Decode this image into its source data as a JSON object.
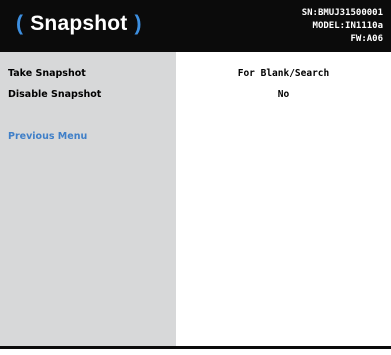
{
  "header": {
    "title_open": "(",
    "title": "Snapshot",
    "title_close": ")",
    "serial": "SN:BMUJ31500001",
    "model": "MODEL:IN1110a",
    "firmware": "FW:A06"
  },
  "menu": {
    "items": [
      {
        "label": "Take Snapshot",
        "value": "For Blank/Search"
      },
      {
        "label": "Disable Snapshot",
        "value": "No"
      }
    ],
    "previous_menu": "Previous Menu"
  },
  "colors": {
    "header_bg": "#0b0b0b",
    "accent": "#3d8fe0",
    "sidebar_bg": "#d7d8d9",
    "link": "#3f7fc8"
  }
}
